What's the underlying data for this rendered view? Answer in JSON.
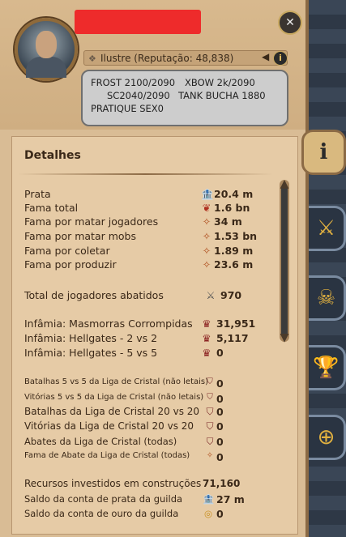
{
  "profile": {
    "reputation": "Ilustre (Reputação: 48,838)",
    "bio": {
      "line1a": "FROST 2100/2090",
      "line1b": "XBOW 2k/2090",
      "line2a": "SC2040/2090",
      "line2b": "TANK BUCHA 1880",
      "line3": "PRATIQUE SEX0"
    },
    "close": "✕",
    "info": "i",
    "arrow": "◀"
  },
  "details": {
    "title": "Detalhes",
    "rows": [
      {
        "label": "Prata",
        "icon": "🏦",
        "value": "20.4 m"
      },
      {
        "label": "Fama total",
        "icon": "❦",
        "value": "1.6 bn"
      },
      {
        "label": "Fama por matar jogadores",
        "icon": "✧",
        "value": "34 m"
      },
      {
        "label": "Fama por matar mobs",
        "icon": "✧",
        "value": "1.53 bn"
      },
      {
        "label": "Fama por coletar",
        "icon": "✧",
        "value": "1.89 m"
      },
      {
        "label": "Fama por produzir",
        "icon": "✧",
        "value": "23.6 m"
      },
      {
        "label": "Total de jogadores abatidos",
        "icon": "⚔",
        "value": "970"
      },
      {
        "label": "Infâmia: Masmorras Corrompidas",
        "icon": "♛",
        "value": "31,951"
      },
      {
        "label": "Infâmia: Hellgates - 2 vs 2",
        "icon": "♛",
        "value": "5,117"
      },
      {
        "label": "Infâmia: Hellgates - 5 vs 5",
        "icon": "♛",
        "value": "0"
      },
      {
        "label": "Batalhas 5 vs 5 da Liga de Cristal (não letais)",
        "icon": "⛉",
        "value": "0"
      },
      {
        "label": "Vitórias 5 vs 5 da Liga de Cristal (não letais)",
        "icon": "⛉",
        "value": "0"
      },
      {
        "label": "Batalhas da Liga de Cristal 20 vs 20",
        "icon": "⛉",
        "value": "0"
      },
      {
        "label": "Vitórias da Liga de Cristal 20 vs 20",
        "icon": "⛉",
        "value": "0"
      },
      {
        "label": "Abates da Liga de Cristal (todas)",
        "icon": "⛉",
        "value": "0"
      },
      {
        "label": "Fama de Abate da Liga de Cristal (todas)",
        "icon": "✧",
        "value": "0"
      },
      {
        "label": "Recursos investidos em construções",
        "icon": "",
        "value": "71,160"
      },
      {
        "label": "Saldo da conta de prata da guilda",
        "icon": "🏦",
        "value": "27 m"
      },
      {
        "label": "Saldo da conta de ouro da guilda",
        "icon": "◎",
        "value": "0"
      }
    ]
  },
  "tabs": {
    "info": "i",
    "pvp": "⚔",
    "skull": "☠",
    "trophy": "🏆",
    "guild": "⊕"
  },
  "colors": {
    "parchment": "#d9bc95",
    "panel": "#e6cba6",
    "text": "#3a2818",
    "redaction": "#ee2b2b"
  }
}
